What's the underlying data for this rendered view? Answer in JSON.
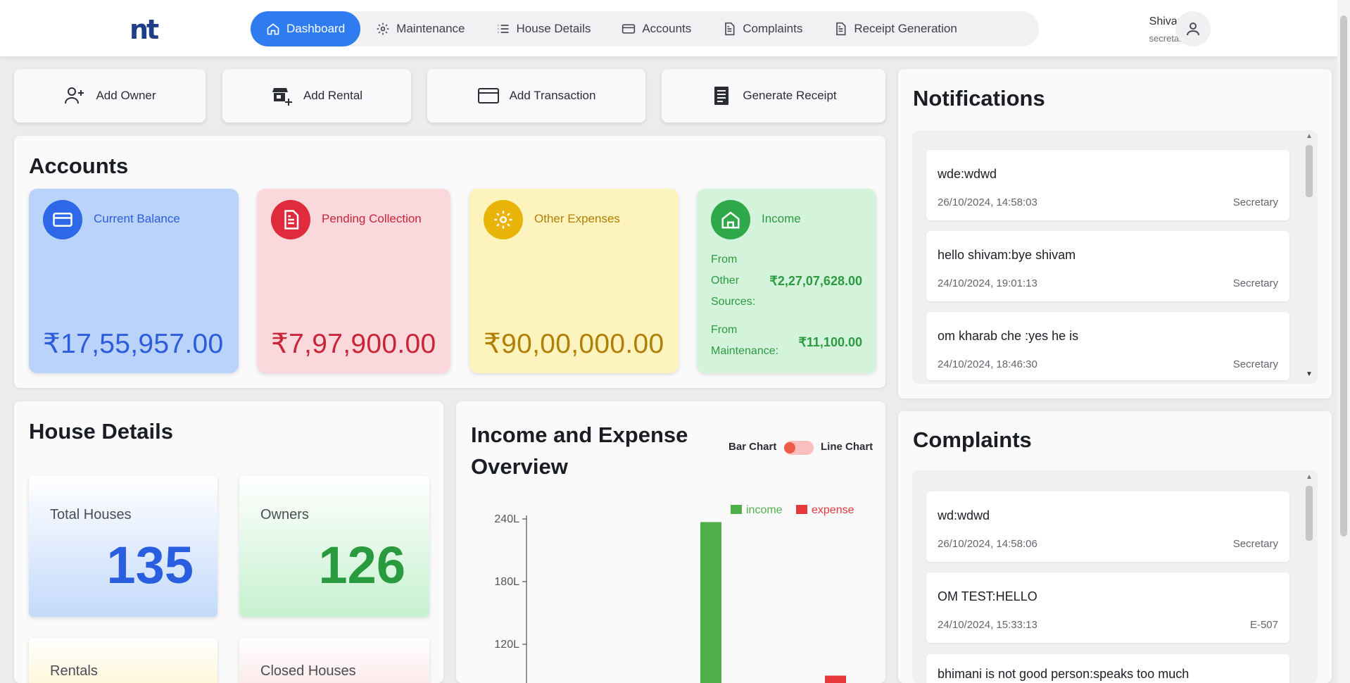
{
  "app": {
    "logo": "nt"
  },
  "nav": {
    "items": [
      {
        "label": "Dashboard",
        "icon": "home-icon",
        "active": true
      },
      {
        "label": "Maintenance",
        "icon": "gear-icon",
        "active": false
      },
      {
        "label": "House Details",
        "icon": "list-icon",
        "active": false
      },
      {
        "label": "Accounts",
        "icon": "card-icon",
        "active": false
      },
      {
        "label": "Complaints",
        "icon": "document-icon",
        "active": false
      },
      {
        "label": "Receipt Generation",
        "icon": "document-icon",
        "active": false
      }
    ]
  },
  "user": {
    "name": "Shivam",
    "role": "secretary",
    "icon": "user-icon"
  },
  "quick_actions": [
    {
      "label": "Add Owner",
      "icon": "add-user-icon"
    },
    {
      "label": "Add Rental",
      "icon": "add-store-icon"
    },
    {
      "label": "Add Transaction",
      "icon": "card-icon"
    },
    {
      "label": "Generate Receipt",
      "icon": "receipt-icon"
    }
  ],
  "accounts": {
    "title": "Accounts",
    "current_balance": {
      "label": "Current Balance",
      "amount": "₹17,55,957.00",
      "color": "#2d5bdb"
    },
    "pending_collection": {
      "label": "Pending Collection",
      "amount": "₹7,97,900.00",
      "color": "#c8253a"
    },
    "other_expenses": {
      "label": "Other Expenses",
      "amount": "₹90,00,000.00",
      "color": "#c28a06"
    },
    "income": {
      "label": "Income",
      "other_sources_label_1": "From",
      "other_sources_label_2": "Other",
      "other_sources_label_3": "Sources:",
      "other_sources_amount": "₹2,27,07,628.00",
      "maintenance_label_1": "From",
      "maintenance_label_2": "Maintenance:",
      "maintenance_amount": "₹11,100.00",
      "color": "#2c9a40"
    }
  },
  "house_details": {
    "title": "House Details",
    "total_houses": {
      "label": "Total Houses",
      "value": "135"
    },
    "owners": {
      "label": "Owners",
      "value": "126"
    },
    "rentals": {
      "label": "Rentals"
    },
    "closed_houses": {
      "label": "Closed Houses"
    }
  },
  "overview": {
    "title_line1": "Income and Expense",
    "title_line2": "Overview",
    "toggle_left": "Bar Chart",
    "toggle_right": "Line Chart"
  },
  "chart_data": {
    "type": "bar",
    "legend": [
      "income",
      "expense"
    ],
    "y_ticks": [
      "240L",
      "180L",
      "120L"
    ],
    "series": [
      {
        "name": "income",
        "color": "#4fb04a",
        "values": [
          237
        ]
      },
      {
        "name": "expense",
        "color": "#e5393c",
        "values": [
          90
        ]
      }
    ]
  },
  "notifications": {
    "title": "Notifications",
    "items": [
      {
        "text": "wde:wdwd",
        "date": "26/10/2024, 14:58:03",
        "from": "Secretary"
      },
      {
        "text": "hello shivam:bye shivam",
        "date": "24/10/2024, 19:01:13",
        "from": "Secretary"
      },
      {
        "text": "om kharab che :yes he is",
        "date": "24/10/2024, 18:46:30",
        "from": "Secretary"
      }
    ]
  },
  "complaints": {
    "title": "Complaints",
    "items": [
      {
        "text": "wd:wdwd",
        "date": "26/10/2024, 14:58:06",
        "from": "Secretary"
      },
      {
        "text": "OM TEST:HELLO",
        "date": "24/10/2024, 15:33:13",
        "from": "E-507"
      },
      {
        "text": "bhimani is not good person:speaks too much"
      }
    ]
  }
}
